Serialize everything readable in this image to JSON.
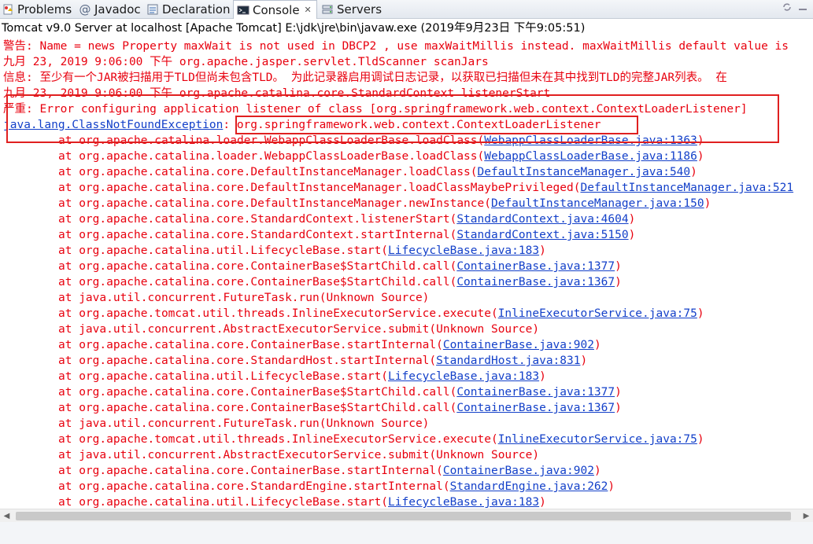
{
  "tabs": [
    {
      "label": "Problems",
      "icon": "problems-icon",
      "active": false
    },
    {
      "label": "Javadoc",
      "icon": "javadoc-icon",
      "active": false
    },
    {
      "label": "Declaration",
      "icon": "declaration-icon",
      "active": false
    },
    {
      "label": "Console",
      "icon": "console-icon",
      "active": true,
      "close": "✕"
    },
    {
      "label": "Servers",
      "icon": "servers-icon",
      "active": false
    }
  ],
  "process_label": "Tomcat v9.0 Server at localhost [Apache Tomcat] E:\\jdk\\jre\\bin\\javaw.exe (2019年9月23日 下午9:05:51)",
  "console": {
    "l1": "警告: Name = news Property maxWait is not used in DBCP2 , use maxWaitMillis instead. maxWaitMillis default value is",
    "l2": "九月 23, 2019 9:06:00 下午 org.apache.jasper.servlet.TldScanner scanJars",
    "l3": "信息: 至少有一个JAR被扫描用于TLD但尚未包含TLD。 为此记录器启用调试日志记录，以获取已扫描但未在其中找到TLD的完整JAR列表。 在",
    "l4": "九月 23, 2019 9:06:00 下午 org.apache.catalina.core.StandardContext listenerStart",
    "l5": "严重: Error configuring application listener of class [org.springframework.web.context.ContextLoaderListener]",
    "exception_link": "java.lang.ClassNotFoundException",
    "exception_sep": ": ",
    "exception_msg": "org.springframework.web.context.ContextLoaderListener",
    "frames": [
      {
        "text": "at org.apache.catalina.loader.WebappClassLoaderBase.loadClass(",
        "link": "WebappClassLoaderBase.java:1363",
        "end": ")"
      },
      {
        "text": "at org.apache.catalina.loader.WebappClassLoaderBase.loadClass(",
        "link": "WebappClassLoaderBase.java:1186",
        "end": ")"
      },
      {
        "text": "at org.apache.catalina.core.DefaultInstanceManager.loadClass(",
        "link": "DefaultInstanceManager.java:540",
        "end": ")"
      },
      {
        "text": "at org.apache.catalina.core.DefaultInstanceManager.loadClassMaybePrivileged(",
        "link": "DefaultInstanceManager.java:521",
        "end": ""
      },
      {
        "text": "at org.apache.catalina.core.DefaultInstanceManager.newInstance(",
        "link": "DefaultInstanceManager.java:150",
        "end": ")"
      },
      {
        "text": "at org.apache.catalina.core.StandardContext.listenerStart(",
        "link": "StandardContext.java:4604",
        "end": ")"
      },
      {
        "text": "at org.apache.catalina.core.StandardContext.startInternal(",
        "link": "StandardContext.java:5150",
        "end": ")"
      },
      {
        "text": "at org.apache.catalina.util.LifecycleBase.start(",
        "link": "LifecycleBase.java:183",
        "end": ")"
      },
      {
        "text": "at org.apache.catalina.core.ContainerBase$StartChild.call(",
        "link": "ContainerBase.java:1377",
        "end": ")"
      },
      {
        "text": "at org.apache.catalina.core.ContainerBase$StartChild.call(",
        "link": "ContainerBase.java:1367",
        "end": ")"
      },
      {
        "text": "at java.util.concurrent.FutureTask.run(Unknown Source)",
        "link": "",
        "end": ""
      },
      {
        "text": "at org.apache.tomcat.util.threads.InlineExecutorService.execute(",
        "link": "InlineExecutorService.java:75",
        "end": ")"
      },
      {
        "text": "at java.util.concurrent.AbstractExecutorService.submit(Unknown Source)",
        "link": "",
        "end": ""
      },
      {
        "text": "at org.apache.catalina.core.ContainerBase.startInternal(",
        "link": "ContainerBase.java:902",
        "end": ")"
      },
      {
        "text": "at org.apache.catalina.core.StandardHost.startInternal(",
        "link": "StandardHost.java:831",
        "end": ")"
      },
      {
        "text": "at org.apache.catalina.util.LifecycleBase.start(",
        "link": "LifecycleBase.java:183",
        "end": ")"
      },
      {
        "text": "at org.apache.catalina.core.ContainerBase$StartChild.call(",
        "link": "ContainerBase.java:1377",
        "end": ")"
      },
      {
        "text": "at org.apache.catalina.core.ContainerBase$StartChild.call(",
        "link": "ContainerBase.java:1367",
        "end": ")"
      },
      {
        "text": "at java.util.concurrent.FutureTask.run(Unknown Source)",
        "link": "",
        "end": ""
      },
      {
        "text": "at org.apache.tomcat.util.threads.InlineExecutorService.execute(",
        "link": "InlineExecutorService.java:75",
        "end": ")"
      },
      {
        "text": "at java.util.concurrent.AbstractExecutorService.submit(Unknown Source)",
        "link": "",
        "end": ""
      },
      {
        "text": "at org.apache.catalina.core.ContainerBase.startInternal(",
        "link": "ContainerBase.java:902",
        "end": ")"
      },
      {
        "text": "at org.apache.catalina.core.StandardEngine.startInternal(",
        "link": "StandardEngine.java:262",
        "end": ")"
      },
      {
        "text": "at org.apache.catalina.util.LifecycleBase.start(",
        "link": "LifecycleBase.java:183",
        "end": ")"
      }
    ]
  },
  "colors": {
    "error_text": "#e8000e",
    "link": "#1340c9",
    "highlight_box": "#e02020"
  }
}
